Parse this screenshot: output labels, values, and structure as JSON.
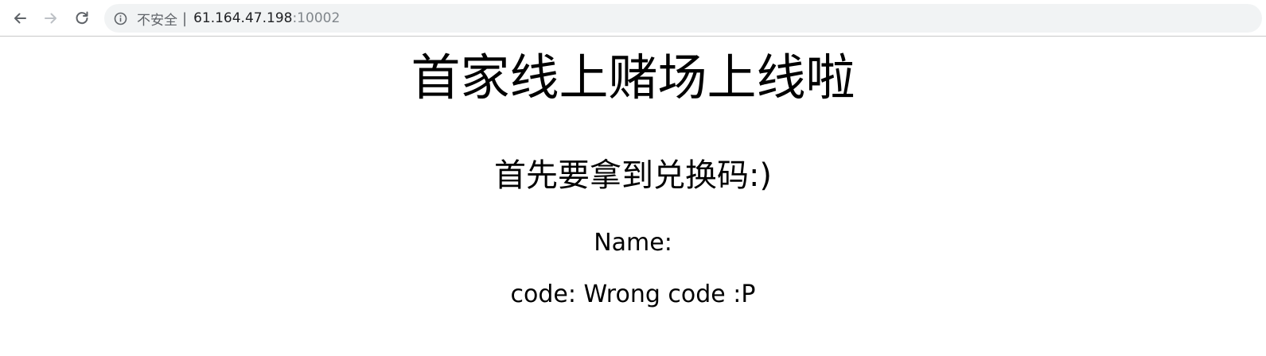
{
  "browser": {
    "security_label": "不安全",
    "separator": "|",
    "url_host": "61.164.47.198",
    "url_port": ":10002",
    "icons": [
      "back-arrow-icon",
      "forward-arrow-icon",
      "reload-icon",
      "info-icon"
    ]
  },
  "page": {
    "heading": "首家线上赌场上线啦",
    "subheading": "首先要拿到兑换码:)",
    "name_line": "Name:",
    "code_line": "code: Wrong code :P"
  }
}
